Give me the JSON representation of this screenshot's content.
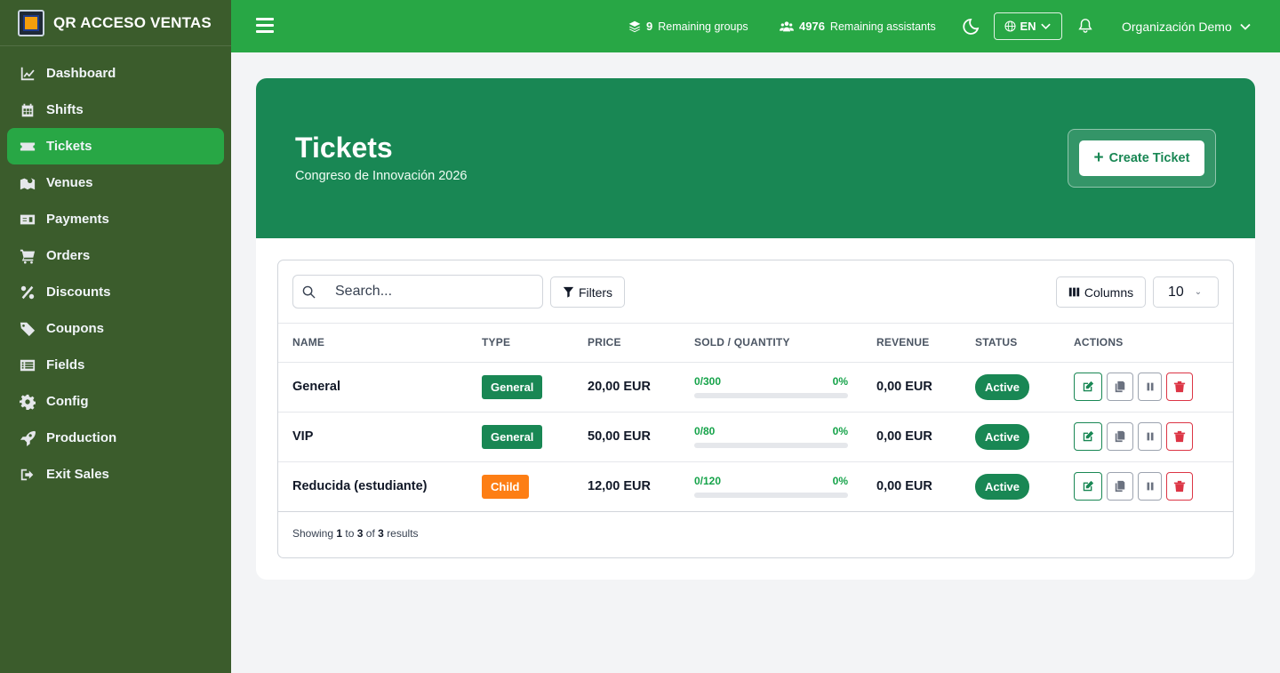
{
  "app": {
    "title": "QR ACCESO VENTAS"
  },
  "sidebar": {
    "items": [
      {
        "label": "Dashboard",
        "icon": "chart-line-icon",
        "active": false
      },
      {
        "label": "Shifts",
        "icon": "calendar-icon",
        "active": false
      },
      {
        "label": "Tickets",
        "icon": "ticket-icon",
        "active": true
      },
      {
        "label": "Venues",
        "icon": "map-icon",
        "active": false
      },
      {
        "label": "Payments",
        "icon": "money-bill-icon",
        "active": false
      },
      {
        "label": "Orders",
        "icon": "cart-icon",
        "active": false
      },
      {
        "label": "Discounts",
        "icon": "percent-icon",
        "active": false
      },
      {
        "label": "Coupons",
        "icon": "tags-icon",
        "active": false
      },
      {
        "label": "Fields",
        "icon": "list-icon",
        "active": false
      },
      {
        "label": "Config",
        "icon": "gear-icon",
        "active": false
      },
      {
        "label": "Production",
        "icon": "rocket-icon",
        "active": false
      },
      {
        "label": "Exit Sales",
        "icon": "sign-out-icon",
        "active": false
      }
    ]
  },
  "topbar": {
    "groups_count": "9",
    "groups_label": "Remaining groups",
    "assistants_count": "4976",
    "assistants_label": "Remaining assistants",
    "language": "EN",
    "organization": "Organización Demo"
  },
  "hero": {
    "title": "Tickets",
    "subtitle": "Congreso de Innovación 2026",
    "create_label": "Create Ticket"
  },
  "toolbar": {
    "search_placeholder": "Search...",
    "filters_label": "Filters",
    "columns_label": "Columns",
    "per_page": "10"
  },
  "table": {
    "headers": [
      "NAME",
      "TYPE",
      "PRICE",
      "SOLD / QUANTITY",
      "REVENUE",
      "STATUS",
      "ACTIONS"
    ],
    "rows": [
      {
        "name": "General",
        "type": "General",
        "type_color": "#198754",
        "price": "20,00 EUR",
        "sold": "0/300",
        "percent": "0%",
        "progress": 0,
        "revenue": "0,00 EUR",
        "status": "Active"
      },
      {
        "name": "VIP",
        "type": "General",
        "type_color": "#198754",
        "price": "50,00 EUR",
        "sold": "0/80",
        "percent": "0%",
        "progress": 0,
        "revenue": "0,00 EUR",
        "status": "Active"
      },
      {
        "name": "Reducida (estudiante)",
        "type": "Child",
        "type_color": "#fd7e14",
        "price": "12,00 EUR",
        "sold": "0/120",
        "percent": "0%",
        "progress": 0,
        "revenue": "0,00 EUR",
        "status": "Active"
      }
    ]
  },
  "pagination": {
    "prefix": "Showing",
    "from": "1",
    "to_word": "to",
    "to": "3",
    "of_word": "of",
    "total": "3",
    "suffix": "results"
  }
}
